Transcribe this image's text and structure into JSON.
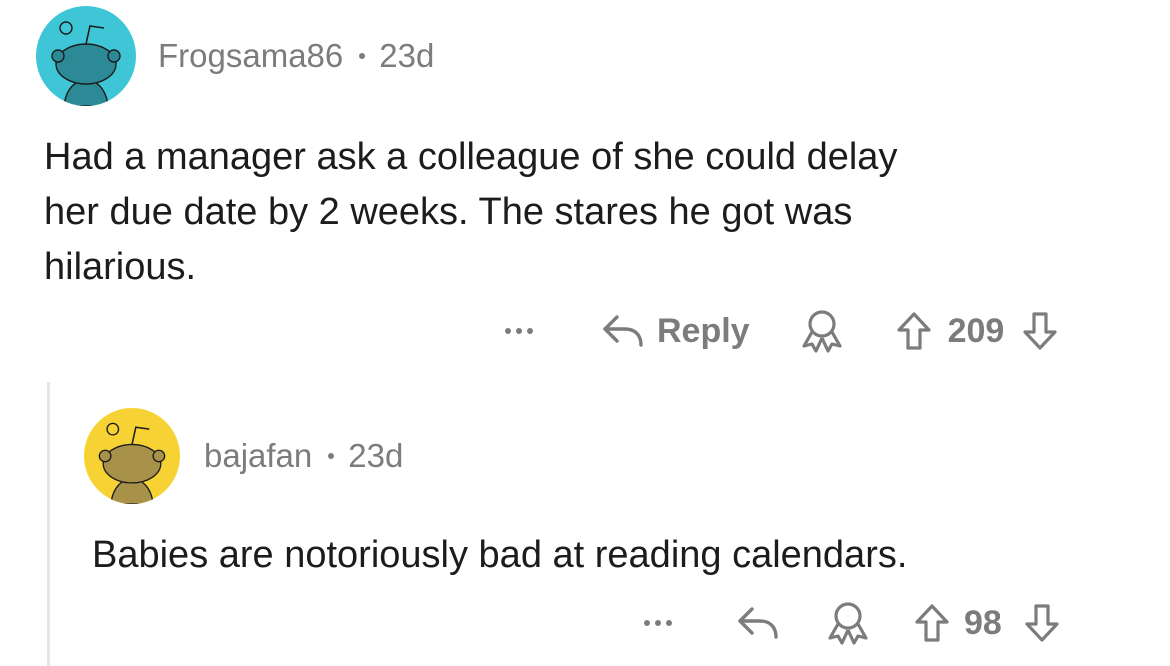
{
  "comments": [
    {
      "username": "Frogsama86",
      "age": "23d",
      "avatar_color": "#3fc6d6",
      "avatar_figure_color": "#2c8a96",
      "body_lines": [
        "Had a manager ask a colleague of she could delay",
        "her due date by 2 weeks. The stares he got was",
        "hilarious."
      ],
      "actions": {
        "more_icon": "ellipsis-icon",
        "reply_icon": "reply-arrow-icon",
        "reply_label": "Reply",
        "award_icon": "award-icon",
        "upvote_icon": "upvote-arrow-icon",
        "score": "209",
        "downvote_icon": "downvote-arrow-icon"
      }
    },
    {
      "username": "bajafan",
      "age": "23d",
      "avatar_color": "#f6d234",
      "avatar_figure_color": "#a8924a",
      "body_lines": [
        "Babies are notoriously bad at reading calendars."
      ],
      "actions": {
        "more_icon": "ellipsis-icon",
        "reply_icon": "reply-arrow-icon",
        "award_icon": "award-icon",
        "upvote_icon": "upvote-arrow-icon",
        "score": "98",
        "downvote_icon": "downvote-arrow-icon"
      }
    }
  ]
}
